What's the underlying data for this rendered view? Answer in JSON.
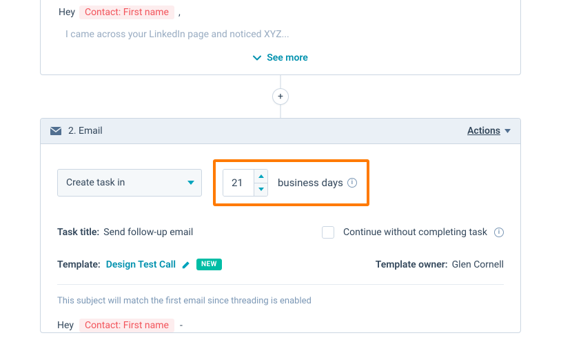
{
  "card1": {
    "greeting": "Hey",
    "token": "Contact: First name",
    "comma": ",",
    "body_placeholder": "I came across your LinkedIn page and noticed XYZ...",
    "see_more": "See more"
  },
  "connector": {
    "plus": "+"
  },
  "card2": {
    "header": {
      "title": "2. Email",
      "actions_label": "Actions"
    },
    "delay": {
      "select_label": "Create task in",
      "days_value": "21",
      "unit_label": "business days"
    },
    "task_title": {
      "label": "Task title:",
      "value": "Send follow-up email"
    },
    "continue": {
      "label": "Continue without completing task"
    },
    "template": {
      "label": "Template:",
      "name": "Design Test Call",
      "new_badge": "NEW",
      "owner_label": "Template owner:",
      "owner_name": "Glen Cornell"
    },
    "note": "This subject will match the first email since threading is enabled",
    "preview": {
      "greeting": "Hey",
      "token": "Contact: First name",
      "tail": "-"
    }
  },
  "info_glyph": "i"
}
